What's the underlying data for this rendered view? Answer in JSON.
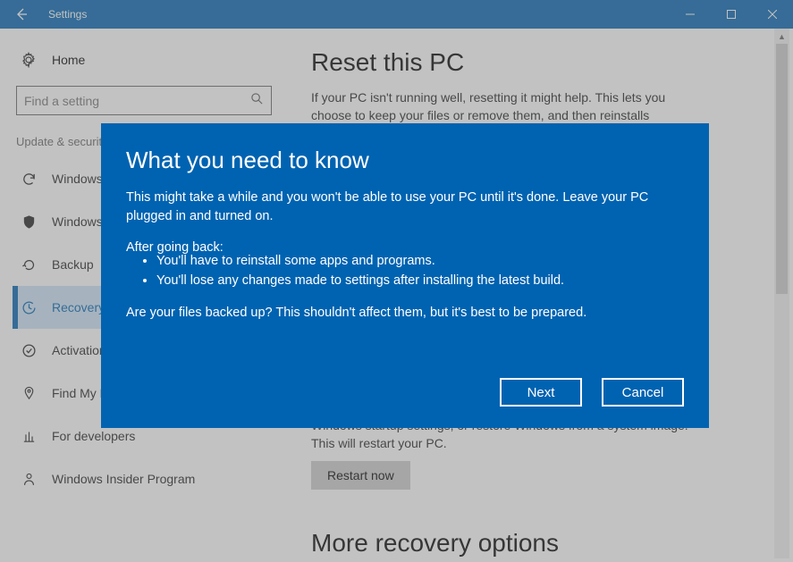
{
  "window": {
    "title": "Settings"
  },
  "sidebar": {
    "home_label": "Home",
    "search_placeholder": "Find a setting",
    "group_label": "Update & security",
    "items": [
      {
        "label": "Windows Update"
      },
      {
        "label": "Windows Defender"
      },
      {
        "label": "Backup"
      },
      {
        "label": "Recovery"
      },
      {
        "label": "Activation"
      },
      {
        "label": "Find My Device"
      },
      {
        "label": "For developers"
      },
      {
        "label": "Windows Insider Program"
      }
    ]
  },
  "main": {
    "reset_heading": "Reset this PC",
    "reset_text": "If your PC isn't running well, resetting it might help. This lets you choose to keep your files or remove them, and then reinstalls",
    "advanced_text": "Windows startup settings, or restore Windows from a system image. This will restart your PC.",
    "restart_label": "Restart now",
    "more_heading": "More recovery options"
  },
  "dialog": {
    "title": "What you need to know",
    "p1": "This might take a while and you won't be able to use your PC until it's done. Leave your PC plugged in and turned on.",
    "after_label": "After going back:",
    "b1": "You'll have to reinstall some apps and programs.",
    "b2": "You'll lose any changes made to settings after installing the latest build.",
    "p3": "Are your files backed up? This shouldn't affect them, but it's best to be prepared.",
    "next": "Next",
    "cancel": "Cancel"
  }
}
